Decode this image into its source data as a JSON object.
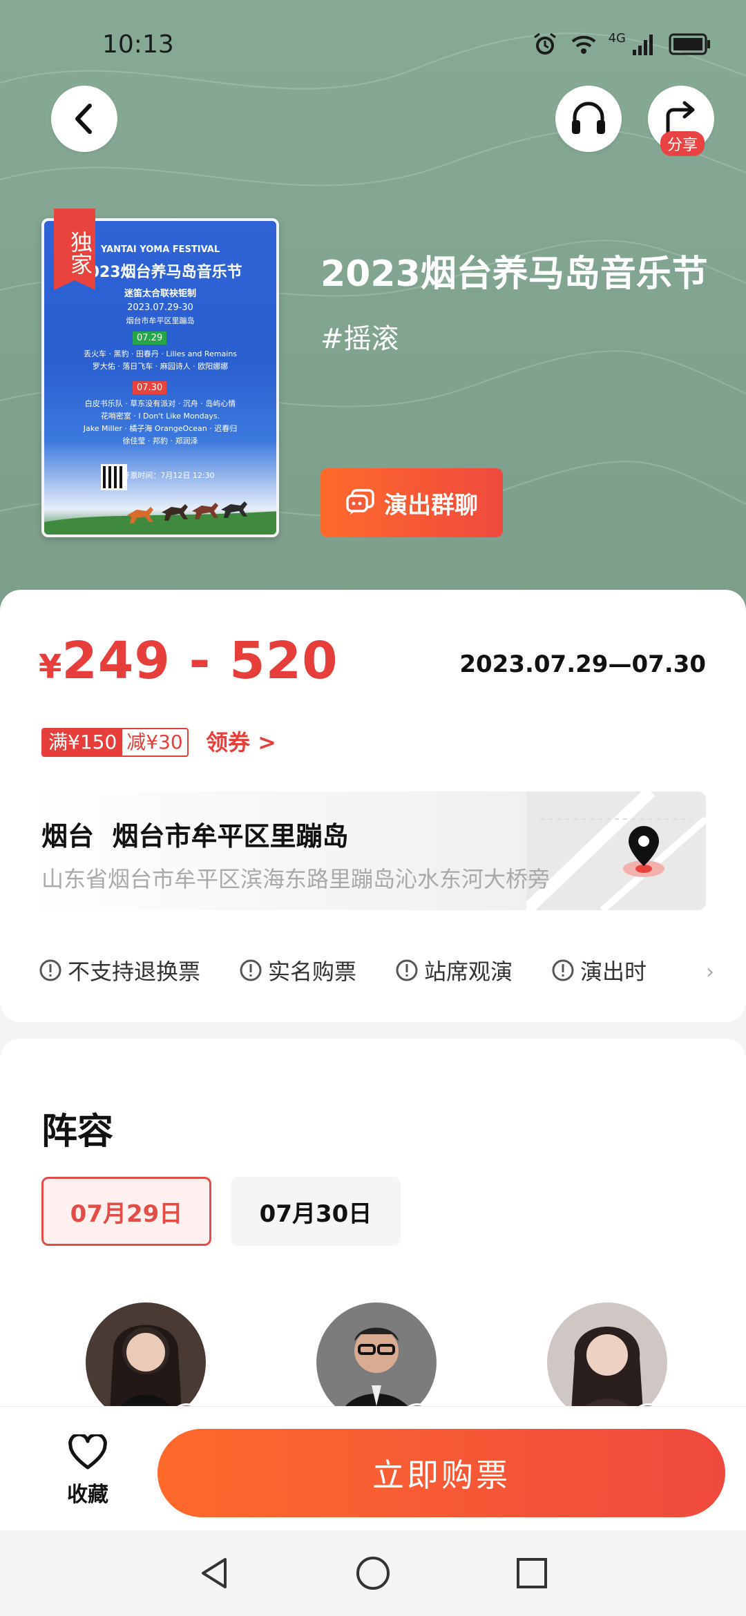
{
  "status_bar": {
    "time": "10:13",
    "network": "4G"
  },
  "header": {
    "share_label": "分享"
  },
  "poster": {
    "exclusive_label": "独家",
    "line1": "YANTAI YOMA FESTIVAL",
    "line2": "2023烟台养马岛音乐节",
    "line3": "迷笛太合联袂钜制",
    "line4": "2023.07.29-30",
    "line5": "烟台市牟平区里蹦岛",
    "tag1": "07.29",
    "tag2": "07.30",
    "performers1": "丢火车 · 黑豹 · 田春丹 · Lilies and Remains",
    "performers2": "罗大佑 · 落日飞车 · 麻园诗人 · 欧阳娜娜",
    "performers3": "白皮书乐队 · 草东没有派对 · 沉舟 · 岛屿心情",
    "performers4": "花哨密室 · I Don't Like Mondays.",
    "performers5": "Jake Miller · 橘子海 OrangeOcean · 迟春归",
    "performers6": "徐佳莹 · 邦豹 · 郑润泽",
    "sale_time": "开票时间：7月12日 12:30"
  },
  "event": {
    "title": "2023烟台养马岛音乐节",
    "tag": "#摇滚",
    "group_chat_label": "演出群聊"
  },
  "info": {
    "price_symbol": "¥",
    "price_range": "249 - 520",
    "date_range": "2023.07.29—07.30",
    "coupon_threshold": "满¥150",
    "coupon_discount": "减¥30",
    "coupon_link": "领券 >",
    "venue_title": "烟台  烟台市牟平区里蹦岛",
    "venue_address": "山东省烟台市牟平区滨海东路里蹦岛沁水东河大桥旁",
    "policies": [
      "不支持退换票",
      "实名购票",
      "站席观演",
      "演出时"
    ],
    "policy_more": "›"
  },
  "lineup": {
    "title": "阵容",
    "tabs": [
      "07月29日",
      "07月30日"
    ],
    "active_tab": 0
  },
  "bottom": {
    "favorite_label": "收藏",
    "buy_label": "立即购票"
  },
  "colors": {
    "accent": "#e63f3b",
    "hero": "#86aa96",
    "button_gradient_start": "#ff6a2b",
    "button_gradient_end": "#ef4a3f"
  }
}
